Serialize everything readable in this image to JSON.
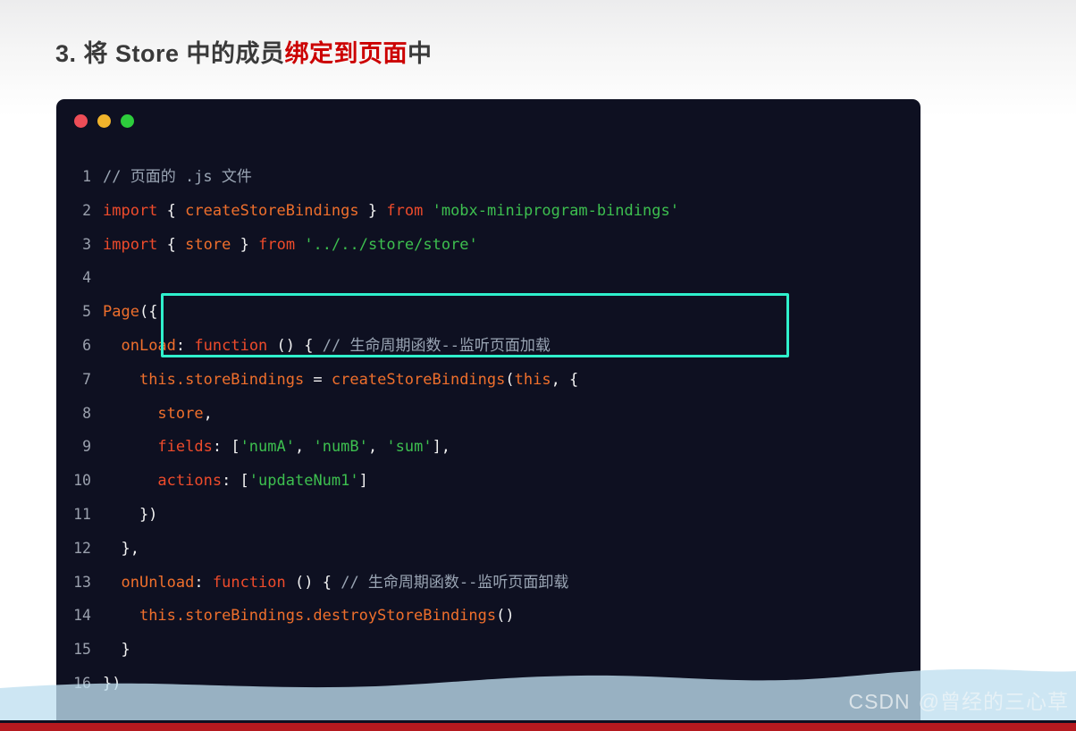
{
  "title": {
    "prefix": "3. 将 Store 中的成员",
    "highlight": "绑定到页面",
    "suffix": "中"
  },
  "window": {
    "dots": [
      "close-dot",
      "minimize-dot",
      "maximize-dot"
    ]
  },
  "code": {
    "language": "javascript",
    "highlight_box_lines": [
      2,
      3
    ],
    "lines": [
      {
        "num": "1",
        "tokens": [
          {
            "t": "// 页面的 .js 文件",
            "c": "t-cmt"
          }
        ]
      },
      {
        "num": "2",
        "tokens": [
          {
            "t": "import",
            "c": "t-kw"
          },
          {
            "t": " ",
            "c": "t-plain"
          },
          {
            "t": "{",
            "c": "t-pun"
          },
          {
            "t": " ",
            "c": "t-plain"
          },
          {
            "t": "createStoreBindings",
            "c": "t-id"
          },
          {
            "t": " ",
            "c": "t-plain"
          },
          {
            "t": "}",
            "c": "t-pun"
          },
          {
            "t": " ",
            "c": "t-plain"
          },
          {
            "t": "from",
            "c": "t-kw"
          },
          {
            "t": " ",
            "c": "t-plain"
          },
          {
            "t": "'mobx-miniprogram-bindings'",
            "c": "t-str"
          }
        ]
      },
      {
        "num": "3",
        "tokens": [
          {
            "t": "import",
            "c": "t-kw"
          },
          {
            "t": " ",
            "c": "t-plain"
          },
          {
            "t": "{",
            "c": "t-pun"
          },
          {
            "t": " ",
            "c": "t-plain"
          },
          {
            "t": "store",
            "c": "t-id"
          },
          {
            "t": " ",
            "c": "t-plain"
          },
          {
            "t": "}",
            "c": "t-pun"
          },
          {
            "t": " ",
            "c": "t-plain"
          },
          {
            "t": "from",
            "c": "t-kw"
          },
          {
            "t": " ",
            "c": "t-plain"
          },
          {
            "t": "'../../store/store'",
            "c": "t-str"
          }
        ]
      },
      {
        "num": "4",
        "tokens": [
          {
            "t": "",
            "c": "t-plain"
          }
        ]
      },
      {
        "num": "5",
        "tokens": [
          {
            "t": "Page",
            "c": "t-fn"
          },
          {
            "t": "({",
            "c": "t-pun"
          }
        ]
      },
      {
        "num": "6",
        "tokens": [
          {
            "t": "  ",
            "c": "t-plain"
          },
          {
            "t": "onLoad",
            "c": "t-id"
          },
          {
            "t": ":",
            "c": "t-pun"
          },
          {
            "t": " ",
            "c": "t-plain"
          },
          {
            "t": "function",
            "c": "t-kw"
          },
          {
            "t": " ",
            "c": "t-plain"
          },
          {
            "t": "() {",
            "c": "t-pun"
          },
          {
            "t": " ",
            "c": "t-plain"
          },
          {
            "t": "// 生命周期函数--监听页面加载",
            "c": "t-cmt"
          }
        ]
      },
      {
        "num": "7",
        "tokens": [
          {
            "t": "    ",
            "c": "t-plain"
          },
          {
            "t": "this.storeBindings",
            "c": "t-id"
          },
          {
            "t": " = ",
            "c": "t-pun"
          },
          {
            "t": "createStoreBindings",
            "c": "t-id"
          },
          {
            "t": "(",
            "c": "t-pun"
          },
          {
            "t": "this",
            "c": "t-id"
          },
          {
            "t": ", {",
            "c": "t-pun"
          }
        ]
      },
      {
        "num": "8",
        "tokens": [
          {
            "t": "      ",
            "c": "t-plain"
          },
          {
            "t": "store",
            "c": "t-id"
          },
          {
            "t": ",",
            "c": "t-pun"
          }
        ]
      },
      {
        "num": "9",
        "tokens": [
          {
            "t": "      ",
            "c": "t-plain"
          },
          {
            "t": "fields",
            "c": "t-kw"
          },
          {
            "t": ": [",
            "c": "t-pun"
          },
          {
            "t": "'numA'",
            "c": "t-str"
          },
          {
            "t": ", ",
            "c": "t-pun"
          },
          {
            "t": "'numB'",
            "c": "t-str"
          },
          {
            "t": ", ",
            "c": "t-pun"
          },
          {
            "t": "'sum'",
            "c": "t-str"
          },
          {
            "t": "],",
            "c": "t-pun"
          }
        ]
      },
      {
        "num": "10",
        "tokens": [
          {
            "t": "      ",
            "c": "t-plain"
          },
          {
            "t": "actions",
            "c": "t-kw"
          },
          {
            "t": ": [",
            "c": "t-pun"
          },
          {
            "t": "'updateNum1'",
            "c": "t-str"
          },
          {
            "t": "]",
            "c": "t-pun"
          }
        ]
      },
      {
        "num": "11",
        "tokens": [
          {
            "t": "    })",
            "c": "t-pun"
          }
        ]
      },
      {
        "num": "12",
        "tokens": [
          {
            "t": "  },",
            "c": "t-pun"
          }
        ]
      },
      {
        "num": "13",
        "tokens": [
          {
            "t": "  ",
            "c": "t-plain"
          },
          {
            "t": "onUnload",
            "c": "t-id"
          },
          {
            "t": ":",
            "c": "t-pun"
          },
          {
            "t": " ",
            "c": "t-plain"
          },
          {
            "t": "function",
            "c": "t-kw"
          },
          {
            "t": " ",
            "c": "t-plain"
          },
          {
            "t": "() {",
            "c": "t-pun"
          },
          {
            "t": " ",
            "c": "t-plain"
          },
          {
            "t": "// 生命周期函数--监听页面卸载",
            "c": "t-cmt"
          }
        ]
      },
      {
        "num": "14",
        "tokens": [
          {
            "t": "    ",
            "c": "t-plain"
          },
          {
            "t": "this.storeBindings.destroyStoreBindings",
            "c": "t-id"
          },
          {
            "t": "()",
            "c": "t-pun"
          }
        ]
      },
      {
        "num": "15",
        "tokens": [
          {
            "t": "  }",
            "c": "t-pun"
          }
        ]
      },
      {
        "num": "16",
        "tokens": [
          {
            "t": "})",
            "c": "t-pun"
          }
        ]
      }
    ]
  },
  "watermark": {
    "brand": "CSDN",
    "user": "@曾经的三心草"
  },
  "colors": {
    "code_background": "#0e1021",
    "highlight_border": "#2ff0cc",
    "title_accent": "#cc0000",
    "bottom_bar": "#b5191f",
    "wave": "#3d6680"
  }
}
